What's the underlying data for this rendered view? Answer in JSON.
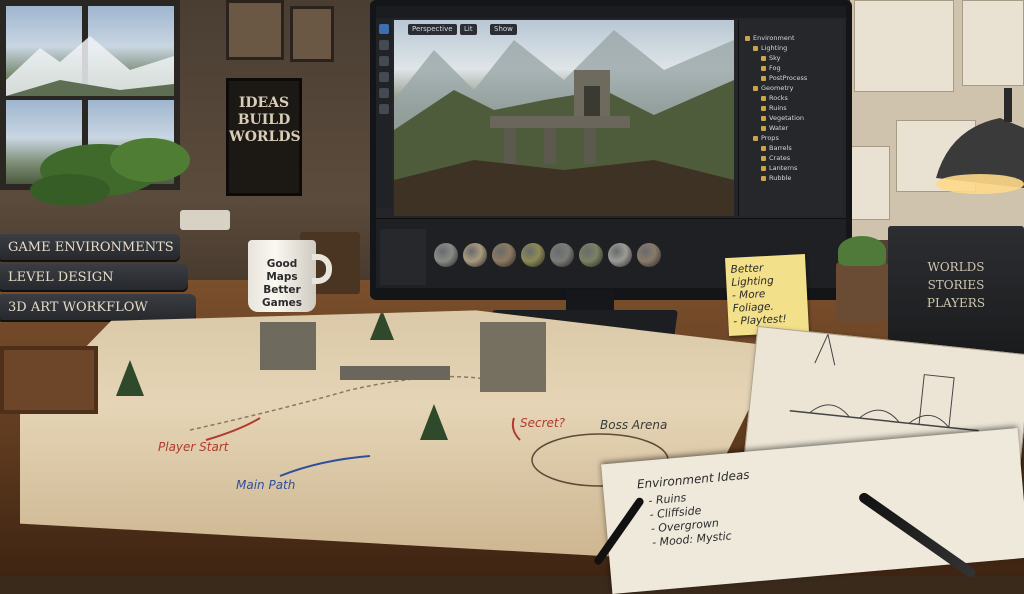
{
  "poster": {
    "lines": [
      "IDEAS",
      "BUILD",
      "WORLDS"
    ]
  },
  "books_left": [
    "GAME ENVIRONMENTS",
    "LEVEL DESIGN",
    "3D ART WORKFLOW"
  ],
  "mug": {
    "lines": [
      "Good",
      "Maps",
      "Better",
      "Games"
    ]
  },
  "editor": {
    "viewport_tabs": [
      "Perspective",
      "Lit",
      "Show"
    ],
    "outliner": [
      {
        "label": "Environment",
        "depth": 0
      },
      {
        "label": "Lighting",
        "depth": 1
      },
      {
        "label": "Sky",
        "depth": 2
      },
      {
        "label": "Fog",
        "depth": 2
      },
      {
        "label": "PostProcess",
        "depth": 2
      },
      {
        "label": "Geometry",
        "depth": 1
      },
      {
        "label": "Rocks",
        "depth": 2
      },
      {
        "label": "Ruins",
        "depth": 2
      },
      {
        "label": "Vegetation",
        "depth": 2
      },
      {
        "label": "Water",
        "depth": 2
      },
      {
        "label": "Props",
        "depth": 1
      },
      {
        "label": "Barrels",
        "depth": 2
      },
      {
        "label": "Crates",
        "depth": 2
      },
      {
        "label": "Lanterns",
        "depth": 2
      },
      {
        "label": "Rubble",
        "depth": 2
      }
    ],
    "material_colors": [
      "#8a8a86",
      "#a89a7e",
      "#8e7a62",
      "#8c8a55",
      "#7b7c78",
      "#7a8262",
      "#9b9b95",
      "#8a7a6a"
    ]
  },
  "sticky_note": {
    "lines": [
      "Better",
      "Lighting",
      "- More Foliage.",
      "- Playtest!"
    ]
  },
  "right_book": {
    "lines": [
      "WORLDS",
      "STORIES",
      "PLAYERS"
    ]
  },
  "map": {
    "labels": {
      "player_start": "Player Start",
      "main_path": "Main Path",
      "secret": "Secret?",
      "boss_arena": "Boss Arena"
    }
  },
  "notebook": {
    "title": "Environment Ideas",
    "items": [
      "- Ruins",
      "- Cliffside",
      "- Overgrown",
      "- Mood: Mystic"
    ]
  },
  "colors": {
    "accent_blue": "#3b6fb0",
    "annotation_red": "#b23a2e",
    "annotation_blue": "#2f4f9a"
  }
}
